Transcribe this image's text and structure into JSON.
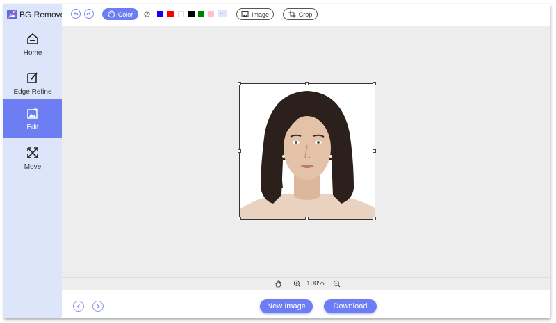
{
  "app": {
    "title": "BG Remover"
  },
  "sidebar": {
    "items": [
      {
        "label": "Home",
        "icon": "home-icon"
      },
      {
        "label": "Edge Refine",
        "icon": "edge-refine-icon"
      },
      {
        "label": "Edit",
        "icon": "edit-image-icon",
        "active": true
      },
      {
        "label": "Move",
        "icon": "move-icon"
      }
    ]
  },
  "toolbar": {
    "undo_icon": "undo-icon",
    "redo_icon": "redo-icon",
    "color_label": "Color",
    "no_color_icon": "no-color-icon",
    "swatches": [
      "#1500ff",
      "#ff0000",
      "#ffffff",
      "#000000",
      "#008000",
      "#ffc0cb"
    ],
    "more_label": "···",
    "image_label": "Image",
    "crop_label": "Crop"
  },
  "zoom": {
    "value": "100%",
    "hand_icon": "hand-icon",
    "zoom_in_icon": "zoom-in-icon",
    "zoom_out_icon": "zoom-out-icon"
  },
  "bottom": {
    "new_image_label": "New Image",
    "download_label": "Download"
  },
  "colors": {
    "accent": "#6d7ef3",
    "sidebar_bg": "#dde5fb",
    "canvas_bg": "#ededed"
  }
}
